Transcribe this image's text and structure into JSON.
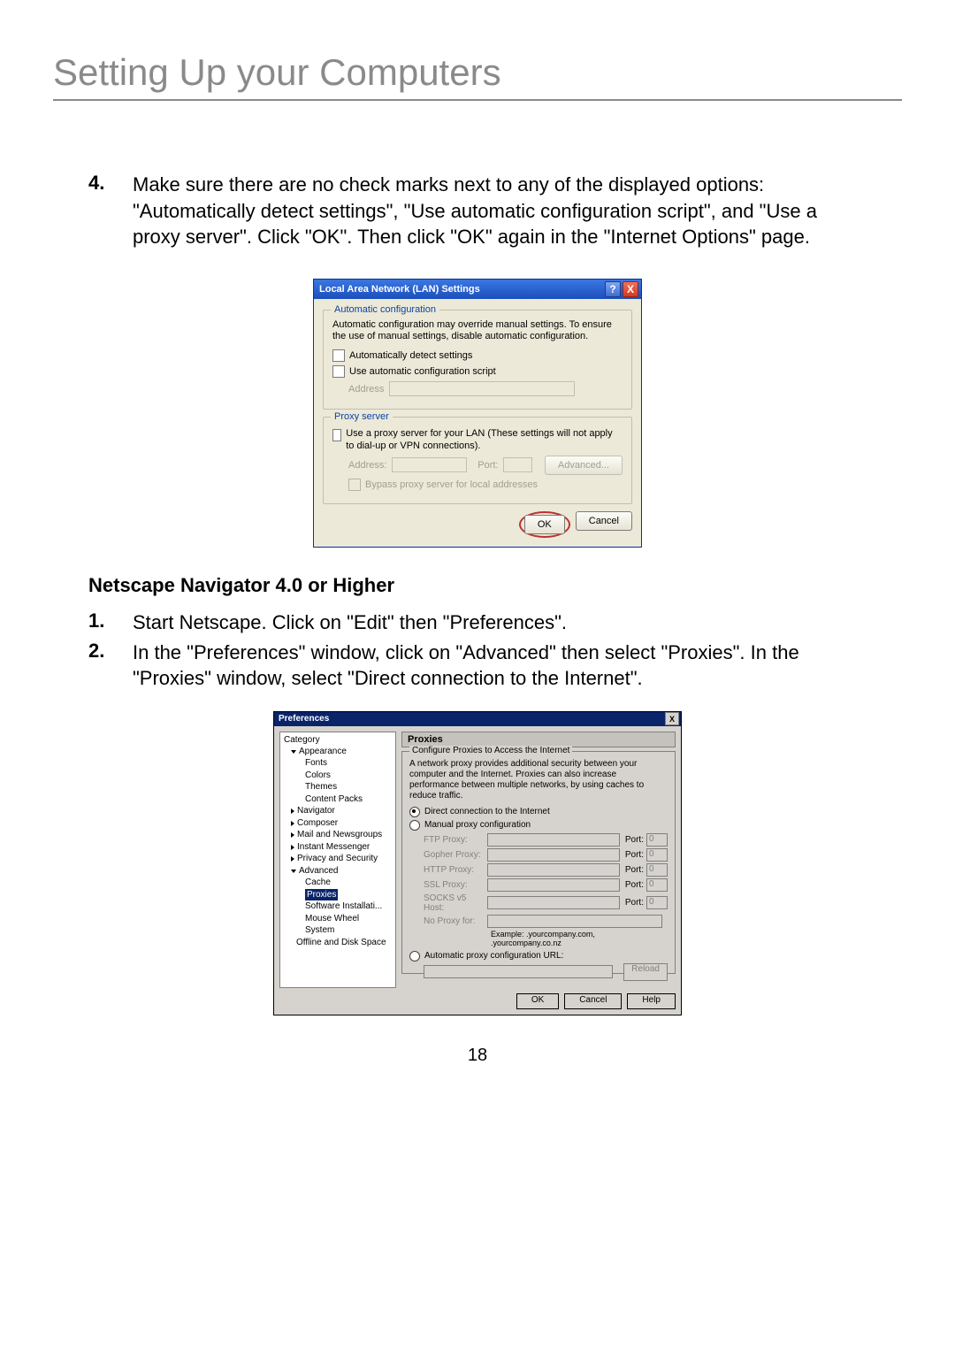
{
  "page_title": "Setting Up your Computers",
  "page_number": "18",
  "step4": {
    "num": "4.",
    "text": "Make sure there are no check marks next to any of the displayed options: \"Automatically detect settings\", \"Use automatic configuration script\", and \"Use a proxy server\". Click \"OK\". Then click \"OK\" again in the \"Internet Options\" page."
  },
  "lan": {
    "title": "Local Area Network (LAN) Settings",
    "help_glyph": "?",
    "close_glyph": "X",
    "group_auto_legend": "Automatic configuration",
    "auto_note": "Automatic configuration may override manual settings.  To ensure the use of manual settings, disable automatic configuration.",
    "chk_auto_detect": "Automatically detect settings",
    "chk_auto_script": "Use automatic configuration script",
    "address_label": "Address",
    "group_proxy_legend": "Proxy server",
    "proxy_note": "Use a proxy server for your LAN (These settings will not apply to dial-up or VPN connections).",
    "addr2_label": "Address:",
    "port_label": "Port:",
    "advanced_label": "Advanced...",
    "bypass_label": "Bypass proxy server for local addresses",
    "ok_label": "OK",
    "cancel_label": "Cancel"
  },
  "subheading": "Netscape Navigator 4.0 or Higher",
  "step1": {
    "num": "1.",
    "text": "Start Netscape. Click on \"Edit\" then \"Preferences\"."
  },
  "step2": {
    "num": "2.",
    "text": "In the \"Preferences\" window, click on \"Advanced\" then select \"Proxies\". In the \"Proxies\" window, select \"Direct connection to the Internet\"."
  },
  "prefs": {
    "title": "Preferences",
    "close_glyph": "X",
    "tree_header": "Category",
    "tree": {
      "appearance": "Appearance",
      "fonts": "Fonts",
      "colors": "Colors",
      "themes": "Themes",
      "content_packs": "Content Packs",
      "navigator": "Navigator",
      "composer": "Composer",
      "mail": "Mail and Newsgroups",
      "im": "Instant Messenger",
      "privacy": "Privacy and Security",
      "advanced": "Advanced",
      "cache": "Cache",
      "proxies": "Proxies",
      "software": "Software Installati...",
      "mouse": "Mouse Wheel",
      "system": "System",
      "offline": "Offline and Disk Space"
    },
    "pane_title": "Proxies",
    "group_legend": "Configure Proxies to Access the Internet",
    "desc": "A network proxy provides additional security between your computer and the Internet. Proxies can also increase performance between multiple networks, by using caches to reduce traffic.",
    "radio_direct": "Direct connection to the Internet",
    "radio_manual": "Manual proxy configuration",
    "ftp_label": "FTP Proxy:",
    "gopher_label": "Gopher Proxy:",
    "http_label": "HTTP Proxy:",
    "ssl_label": "SSL Proxy:",
    "socks_label": "SOCKS v5 Host:",
    "noproxy_label": "No Proxy for:",
    "port_label": "Port:",
    "port_val": "0",
    "example": "Example: .yourcompany.com, .yourcompany.co.nz",
    "radio_auto": "Automatic proxy configuration URL:",
    "reload_label": "Reload",
    "ok": "OK",
    "cancel": "Cancel",
    "help": "Help"
  }
}
